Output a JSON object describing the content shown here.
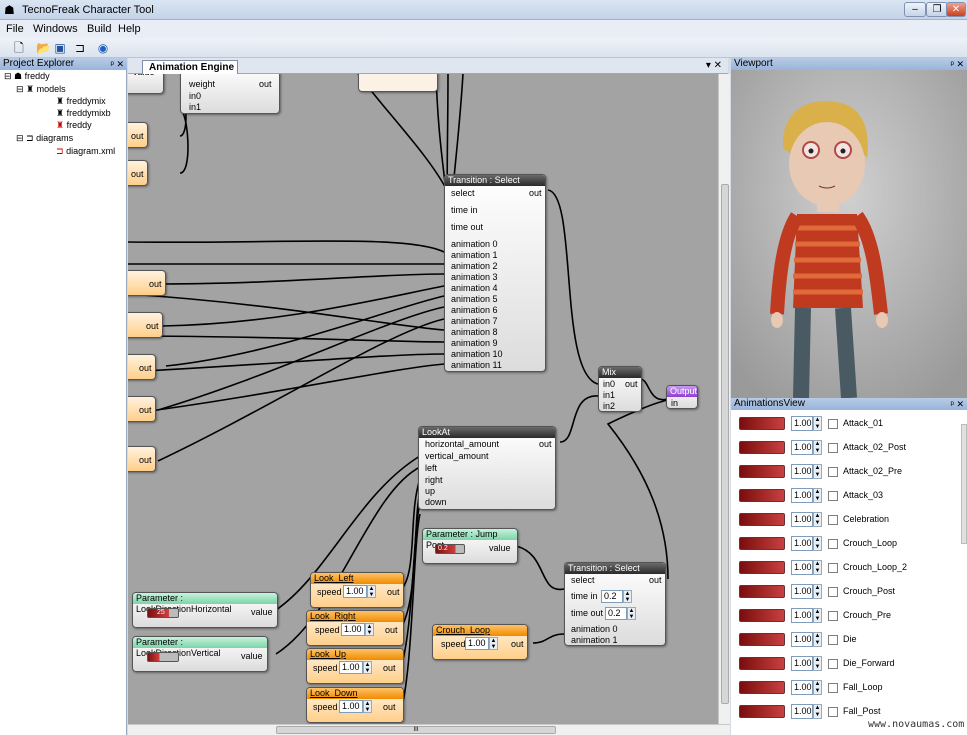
{
  "window": {
    "title": "TecnoFreak Character Tool",
    "min": "–",
    "max": "❐",
    "close": "✕"
  },
  "menu": [
    "File",
    "Windows",
    "Build",
    "Help"
  ],
  "toolbar": [
    "new-file-icon",
    "open-folder-icon",
    "save-icon",
    "diagram-icon",
    "help-icon"
  ],
  "project_explorer": {
    "title": "Project Explorer",
    "pin": "ᵖ ✕",
    "items": [
      "freddy",
      "models",
      "freddymix",
      "freddymixb",
      "freddy",
      "diagrams",
      "diagram.xml"
    ]
  },
  "doc_tab": {
    "title": "Animation Engine",
    "controls": "▾ ✕"
  },
  "nodes": {
    "weight_labels": {
      "weight": "weight",
      "out": "out",
      "in0": "in0",
      "in1": "in1"
    },
    "transition1": {
      "title": "Transition : Select",
      "select": "select",
      "out": "out",
      "time_in": "time in",
      "time_out": "time out",
      "animations": [
        "animation 0",
        "animation 1",
        "animation 2",
        "animation 3",
        "animation 4",
        "animation 5",
        "animation 6",
        "animation 7",
        "animation 8",
        "animation 9",
        "animation 10",
        "animation 11"
      ]
    },
    "mix": {
      "title": "Mix",
      "in0": "in0",
      "in1": "in1",
      "in2": "in2",
      "out": "out"
    },
    "output": {
      "title": "Output",
      "in": "in"
    },
    "lookat": {
      "title": "LookAt",
      "rows": [
        "horizontal_amount",
        "vertical_amount",
        "left",
        "right",
        "up",
        "down"
      ],
      "out": "out"
    },
    "jump_param": {
      "title": "Parameter : Jump Post",
      "value": "value",
      "val": "0.2"
    },
    "transition2": {
      "title": "Transition : Select",
      "select": "select",
      "out": "out",
      "time_in": "time in",
      "time_in_val": "0.2",
      "time_out": "time out",
      "time_out_val": "0.2",
      "a0": "animation 0",
      "a1": "animation 1"
    },
    "look_left": {
      "title": "Look_Left",
      "speed": "speed",
      "val": "1.00",
      "out": "out"
    },
    "look_right": {
      "title": "Look_Right",
      "speed": "speed",
      "val": "1.00",
      "out": "out"
    },
    "look_up": {
      "title": "Look_Up",
      "speed": "speed",
      "val": "1.00",
      "out": "out"
    },
    "look_down": {
      "title": "Look_Down",
      "speed": "speed",
      "val": "1.00",
      "out": "out"
    },
    "crouch_loop": {
      "title": "Crouch_Loop",
      "speed": "speed",
      "val": "1.00",
      "out": "out"
    },
    "param_h": {
      "title": "Parameter : LookDirectionHorizontal",
      "value": "value",
      "val": "25"
    },
    "param_v": {
      "title": "Parameter : LookDirectionVertical",
      "value": "value"
    },
    "out_label": "out",
    "partial_label": "value"
  },
  "viewport": {
    "title": "Viewport",
    "pin": "ᵖ ✕"
  },
  "animations_view": {
    "title": "AnimationsView",
    "pin": "ᵖ ✕",
    "rows": [
      {
        "value": "1.00",
        "name": "Attack_01"
      },
      {
        "value": "1.00",
        "name": "Attack_02_Post"
      },
      {
        "value": "1.00",
        "name": "Attack_02_Pre"
      },
      {
        "value": "1.00",
        "name": "Attack_03"
      },
      {
        "value": "1.00",
        "name": "Celebration"
      },
      {
        "value": "1.00",
        "name": "Crouch_Loop"
      },
      {
        "value": "1.00",
        "name": "Crouch_Loop_2"
      },
      {
        "value": "1.00",
        "name": "Crouch_Post"
      },
      {
        "value": "1.00",
        "name": "Crouch_Pre"
      },
      {
        "value": "1.00",
        "name": "Die"
      },
      {
        "value": "1.00",
        "name": "Die_Forward"
      },
      {
        "value": "1.00",
        "name": "Fall_Loop"
      },
      {
        "value": "1.00",
        "name": "Fall_Post"
      }
    ]
  },
  "scroll": {
    "h_grip": "III"
  },
  "watermark": "www.novaumas.com"
}
